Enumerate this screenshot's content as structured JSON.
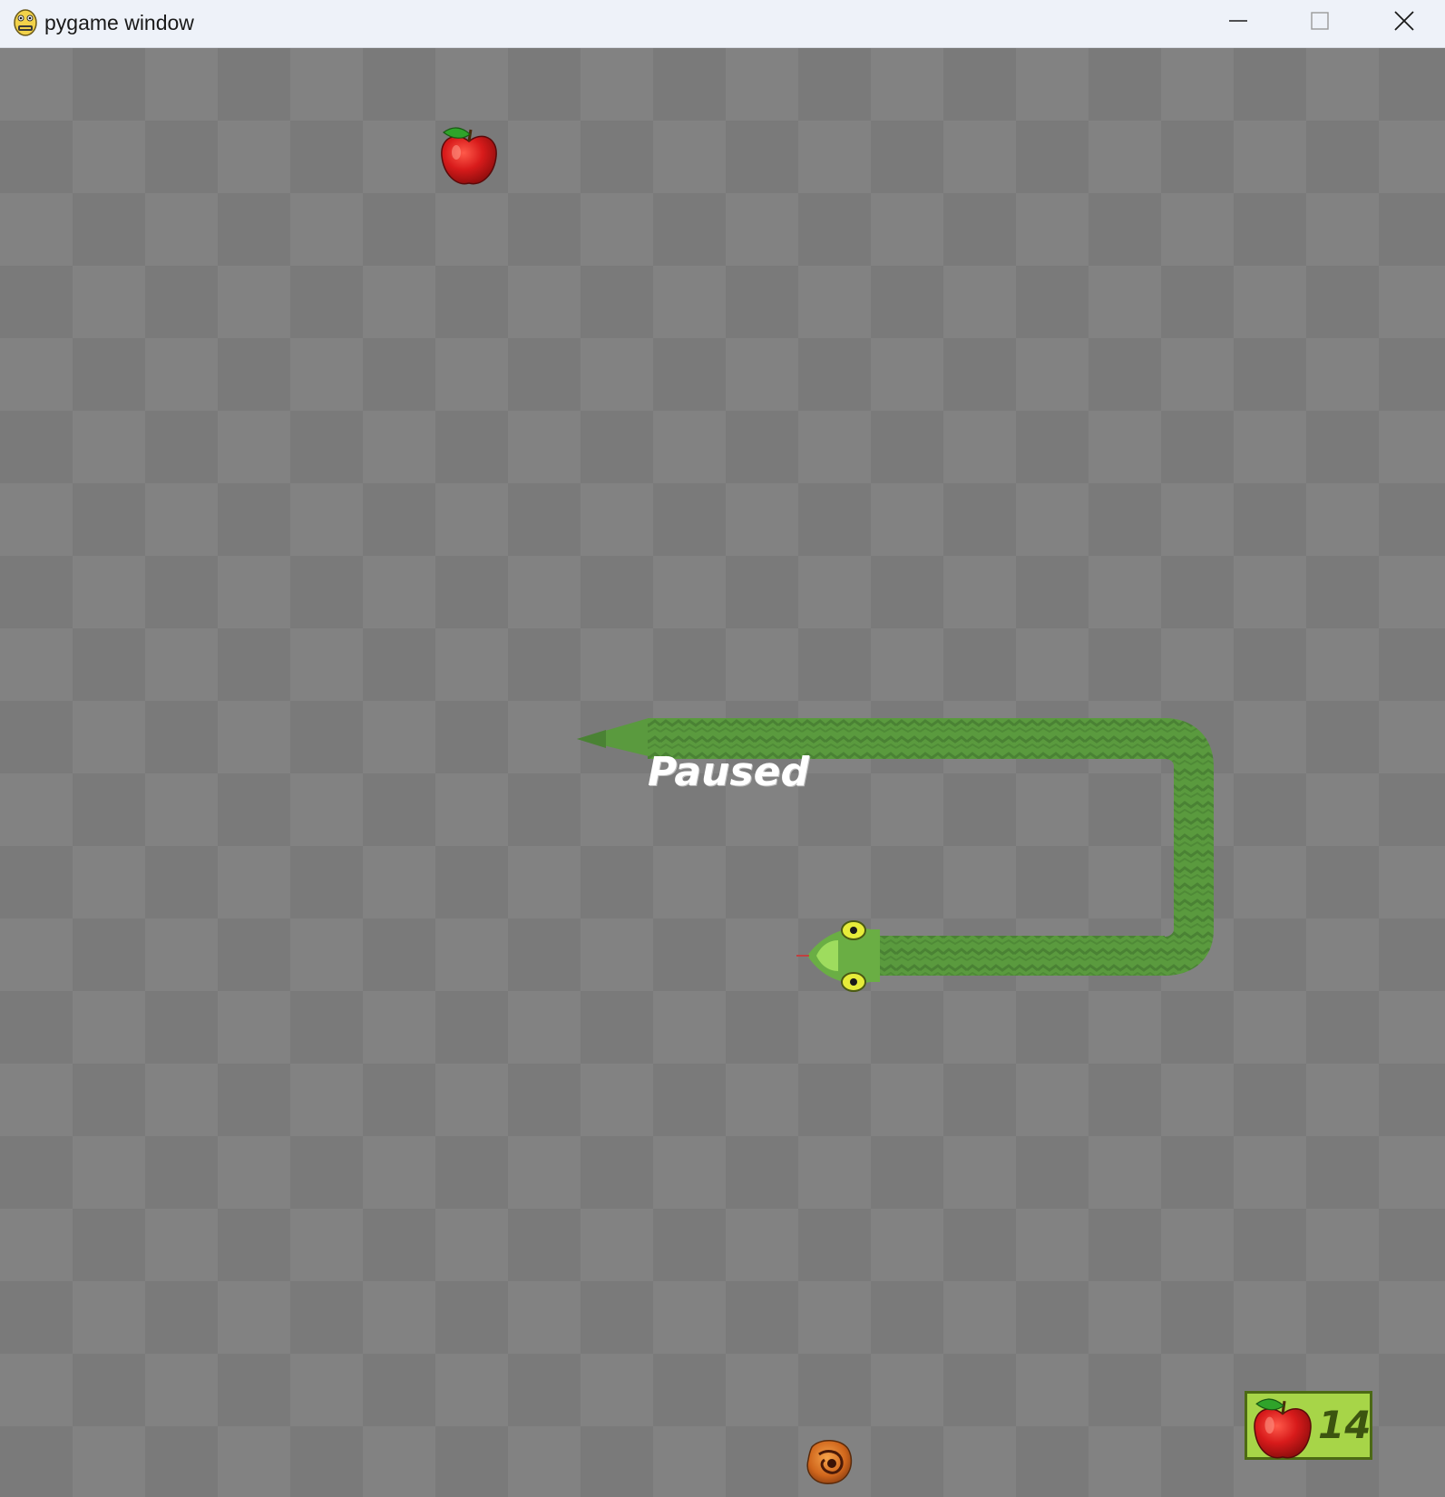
{
  "window": {
    "title": "pygame window",
    "app_icon": "pygame-snake-icon",
    "controls": {
      "minimize": "minimize-icon",
      "maximize": "maximize-icon",
      "close": "close-icon"
    }
  },
  "game": {
    "status_text": "Paused",
    "score": {
      "icon": "apple-icon",
      "value": "14"
    },
    "items": {
      "apple": "apple-icon",
      "bonus_food": "bonus-food-icon"
    },
    "colors": {
      "board_dark": "#7a7a7a",
      "board_light": "#828282",
      "snake_body": "#5a9a3e",
      "snake_head": "#7cc24a",
      "apple": "#d81b1b",
      "score_panel": "#a7d548"
    }
  }
}
